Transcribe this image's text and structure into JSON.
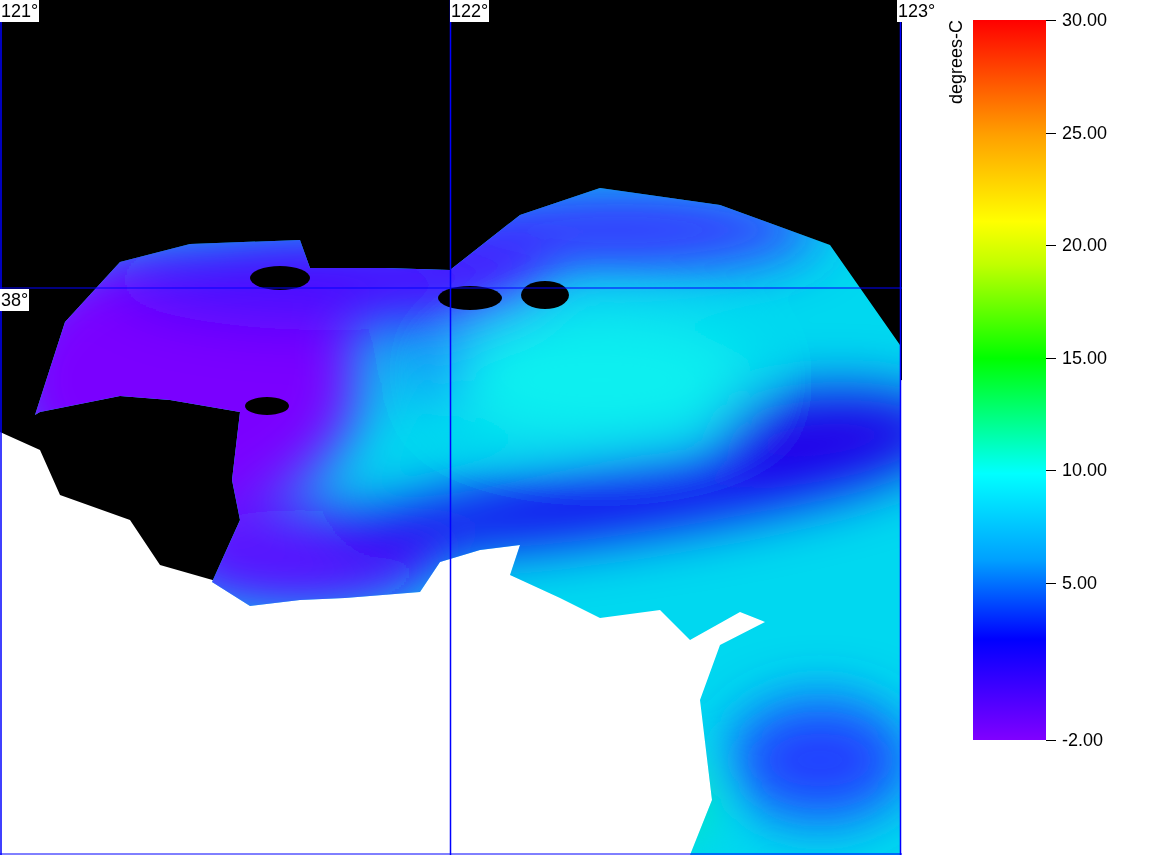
{
  "map": {
    "longitude_labels": [
      "121°",
      "122°",
      "123°"
    ],
    "latitude_labels": [
      "38°"
    ]
  },
  "colorbar": {
    "title": "degrees-C",
    "tick_labels": [
      "30.00",
      "25.00",
      "20.00",
      "15.00",
      "10.00",
      "5.00",
      "-2.00"
    ]
  }
}
